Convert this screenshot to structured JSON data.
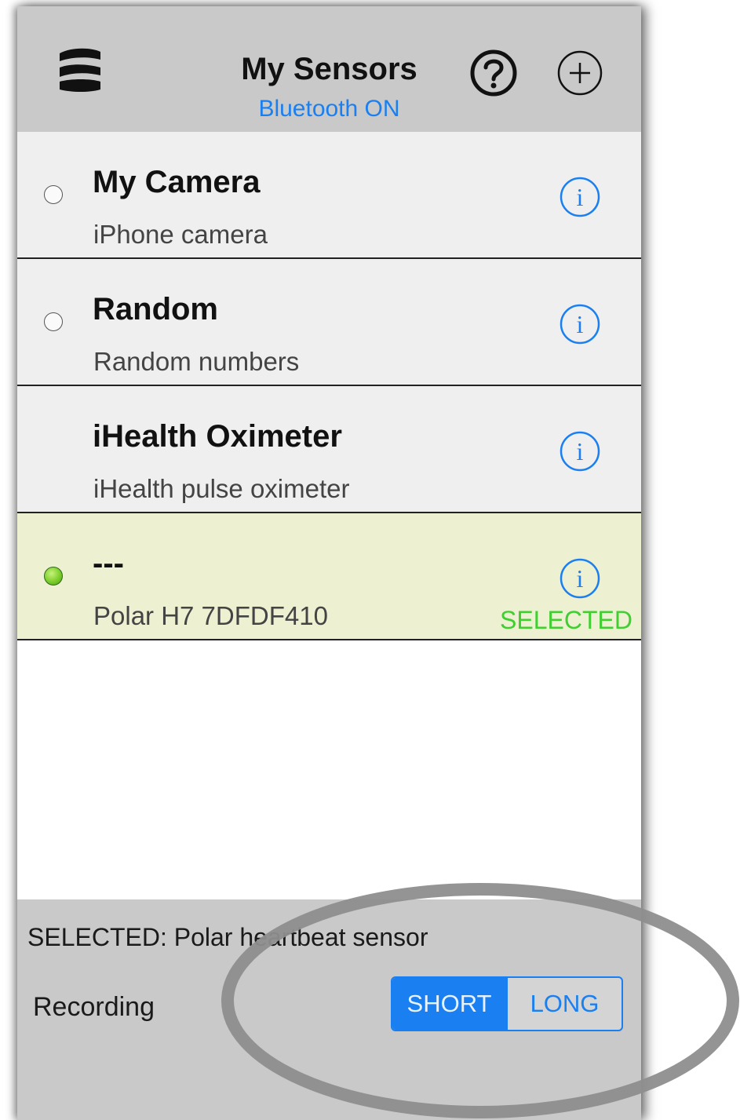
{
  "header": {
    "title": "My Sensors",
    "subtitle": "Bluetooth ON",
    "menu_icon": "menu-icon",
    "help_icon": "question-circle-icon",
    "add_icon": "plus-circle-icon"
  },
  "sensors": [
    {
      "title": "My Camera",
      "subtitle": "iPhone camera",
      "radio": "off"
    },
    {
      "title": "Random",
      "subtitle": "Random numbers",
      "radio": "off"
    },
    {
      "title": "iHealth Oximeter",
      "subtitle": "iHealth pulse oximeter",
      "radio": "none"
    },
    {
      "title": "---",
      "subtitle": "Polar H7 7DFDF410",
      "radio": "on",
      "status": "SELECTED"
    }
  ],
  "footer": {
    "selected_text": "SELECTED: Polar heartbeat sensor",
    "recording_label": "Recording",
    "segment": {
      "options": [
        "SHORT",
        "LONG"
      ],
      "selected": "SHORT"
    }
  },
  "colors": {
    "accent": "#1a7ff0",
    "selected_green": "#3fcf30",
    "selected_row_bg": "#eef0d2",
    "header_bg": "#c9c9c9",
    "row_bg": "#efeff0"
  }
}
